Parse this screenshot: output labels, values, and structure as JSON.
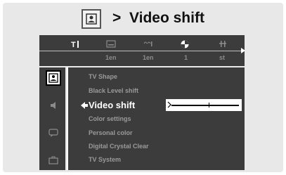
{
  "title": {
    "arrow": ">",
    "text": "Video shift"
  },
  "top_menu": {
    "icons": [
      "tools-icon",
      "subtitle-icon",
      "audio-icon",
      "disc-icon",
      "settings-icon"
    ],
    "labels": [
      "1en",
      "1en",
      "1",
      "st"
    ]
  },
  "side_menu": {
    "icons": [
      "picture-icon",
      "speaker-icon",
      "speech-bubble-icon",
      "briefcase-icon"
    ]
  },
  "menu": {
    "items": [
      "TV Shape",
      "Black Level shift",
      "Video shift",
      "Color settings",
      "Personal color",
      "Digital Crystal Clear",
      "TV System"
    ],
    "selected": "Video shift"
  },
  "slider": {
    "value": 0.55
  }
}
